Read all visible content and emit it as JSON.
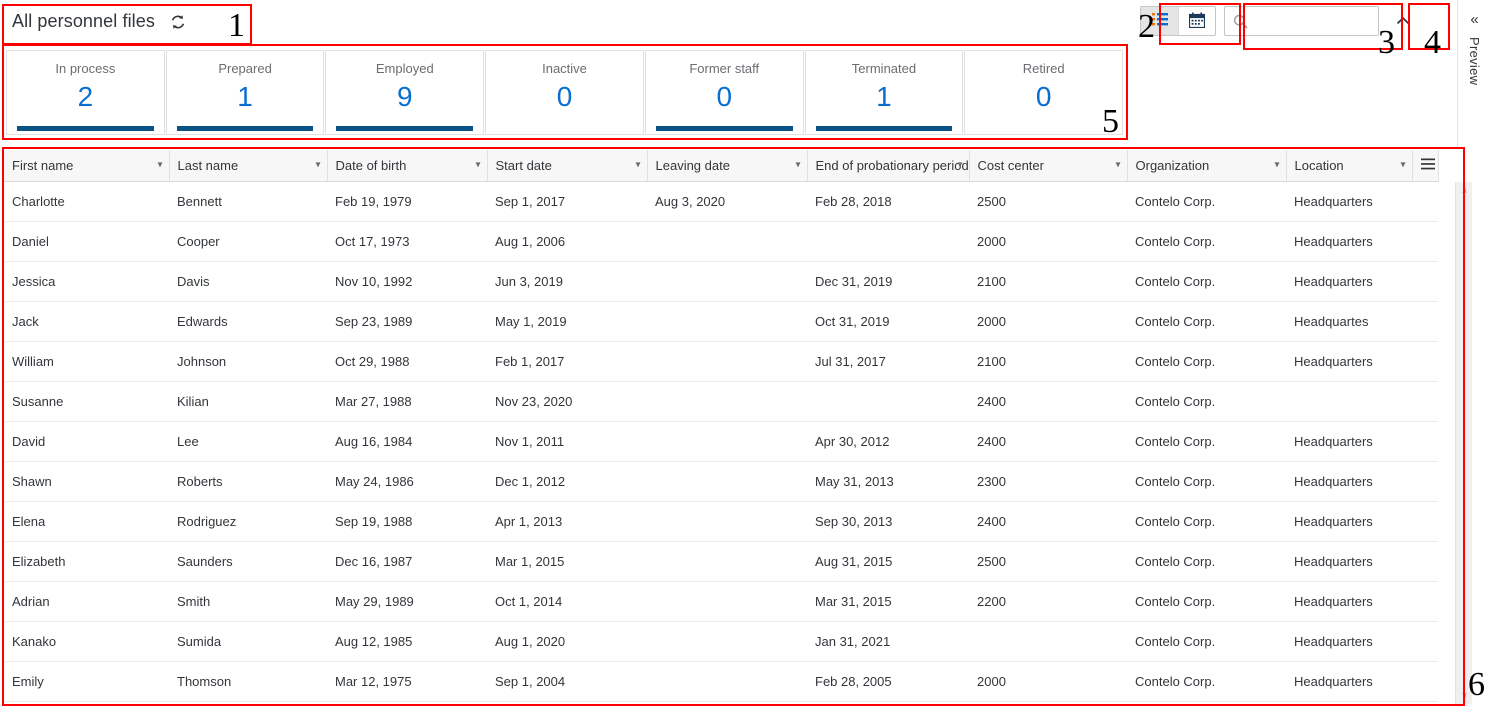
{
  "header": {
    "title": "All personnel files",
    "refresh_icon": "refresh-icon"
  },
  "toolbar": {
    "view_buttons": [
      {
        "icon": "list-view-icon",
        "label": "List view",
        "selected": true
      },
      {
        "icon": "calendar-view-icon",
        "label": "Calendar view",
        "selected": false
      }
    ],
    "search": {
      "placeholder": "",
      "value": "",
      "icon": "search-icon"
    },
    "collapse_icon": "chevron-up-icon"
  },
  "preview_rail": {
    "chevron": "«",
    "label": "Preview"
  },
  "kpis": [
    {
      "label": "In process",
      "value": "2",
      "bar": true
    },
    {
      "label": "Prepared",
      "value": "1",
      "bar": true
    },
    {
      "label": "Employed",
      "value": "9",
      "bar": true
    },
    {
      "label": "Inactive",
      "value": "0",
      "bar": false
    },
    {
      "label": "Former staff",
      "value": "0",
      "bar": true
    },
    {
      "label": "Terminated",
      "value": "1",
      "bar": true
    },
    {
      "label": "Retired",
      "value": "0",
      "bar": false
    }
  ],
  "table": {
    "columns": [
      {
        "label": "First name",
        "chevron": true
      },
      {
        "label": "Last name",
        "chevron": true
      },
      {
        "label": "Date of birth",
        "chevron": true
      },
      {
        "label": "Start date",
        "chevron": true
      },
      {
        "label": "Leaving date",
        "chevron": true
      },
      {
        "label": "End of probationary period",
        "chevron": true
      },
      {
        "label": "Cost center",
        "chevron": true
      },
      {
        "label": "Organization",
        "chevron": true
      },
      {
        "label": "Location",
        "chevron": true
      }
    ],
    "settings_icon": "table-settings-icon",
    "rows": [
      {
        "first_name": "Charlotte",
        "last_name": "Bennett",
        "dob": "Feb 19, 1979",
        "start": "Sep 1, 2017",
        "leaving": "Aug 3, 2020",
        "probation_end": "Feb 28, 2018",
        "cost_center": "2500",
        "organization": "Contelo Corp.",
        "location": "Headquarters"
      },
      {
        "first_name": "Daniel",
        "last_name": "Cooper",
        "dob": "Oct 17, 1973",
        "start": "Aug 1, 2006",
        "leaving": "",
        "probation_end": "",
        "cost_center": "2000",
        "organization": "Contelo Corp.",
        "location": "Headquarters"
      },
      {
        "first_name": "Jessica",
        "last_name": "Davis",
        "dob": "Nov 10, 1992",
        "start": "Jun 3, 2019",
        "leaving": "",
        "probation_end": "Dec 31, 2019",
        "cost_center": "2100",
        "organization": "Contelo Corp.",
        "location": "Headquarters"
      },
      {
        "first_name": "Jack",
        "last_name": "Edwards",
        "dob": "Sep 23, 1989",
        "start": "May 1, 2019",
        "leaving": "",
        "probation_end": "Oct 31, 2019",
        "cost_center": "2000",
        "organization": "Contelo Corp.",
        "location": "Headquartes"
      },
      {
        "first_name": "William",
        "last_name": "Johnson",
        "dob": "Oct 29, 1988",
        "start": "Feb 1, 2017",
        "leaving": "",
        "probation_end": "Jul 31, 2017",
        "cost_center": "2100",
        "organization": "Contelo Corp.",
        "location": "Headquarters"
      },
      {
        "first_name": "Susanne",
        "last_name": "Kilian",
        "dob": "Mar 27, 1988",
        "start": "Nov 23, 2020",
        "leaving": "",
        "probation_end": "",
        "cost_center": "2400",
        "organization": "Contelo Corp.",
        "location": ""
      },
      {
        "first_name": "David",
        "last_name": "Lee",
        "dob": "Aug 16, 1984",
        "start": "Nov 1, 2011",
        "leaving": "",
        "probation_end": "Apr 30, 2012",
        "cost_center": "2400",
        "organization": "Contelo Corp.",
        "location": "Headquarters"
      },
      {
        "first_name": "Shawn",
        "last_name": "Roberts",
        "dob": "May 24, 1986",
        "start": "Dec 1, 2012",
        "leaving": "",
        "probation_end": "May 31, 2013",
        "cost_center": "2300",
        "organization": "Contelo Corp.",
        "location": "Headquarters"
      },
      {
        "first_name": "Elena",
        "last_name": "Rodriguez",
        "dob": "Sep 19, 1988",
        "start": "Apr 1, 2013",
        "leaving": "",
        "probation_end": "Sep 30, 2013",
        "cost_center": "2400",
        "organization": "Contelo Corp.",
        "location": "Headquarters"
      },
      {
        "first_name": "Elizabeth",
        "last_name": "Saunders",
        "dob": "Dec 16, 1987",
        "start": "Mar 1, 2015",
        "leaving": "",
        "probation_end": "Aug 31, 2015",
        "cost_center": "2500",
        "organization": "Contelo Corp.",
        "location": "Headquarters"
      },
      {
        "first_name": "Adrian",
        "last_name": "Smith",
        "dob": "May 29, 1989",
        "start": "Oct 1, 2014",
        "leaving": "",
        "probation_end": "Mar 31, 2015",
        "cost_center": "2200",
        "organization": "Contelo Corp.",
        "location": "Headquarters"
      },
      {
        "first_name": "Kanako",
        "last_name": "Sumida",
        "dob": "Aug 12, 1985",
        "start": "Aug 1, 2020",
        "leaving": "",
        "probation_end": "Jan 31, 2021",
        "cost_center": "",
        "organization": "Contelo Corp.",
        "location": "Headquarters"
      },
      {
        "first_name": "Emily",
        "last_name": "Thomson",
        "dob": "Mar 12, 1975",
        "start": "Sep 1, 2004",
        "leaving": "",
        "probation_end": "Feb 28, 2005",
        "cost_center": "2000",
        "organization": "Contelo Corp.",
        "location": "Headquarters"
      }
    ]
  },
  "scrollbar": {
    "up_arrow": "∧",
    "down_arrow": "∨"
  },
  "annotations": [
    {
      "number": "1"
    },
    {
      "number": "2"
    },
    {
      "number": "3"
    },
    {
      "number": "4"
    },
    {
      "number": "5"
    },
    {
      "number": "6"
    }
  ],
  "colors": {
    "accent_value": "#0a6ed1",
    "kpi_bar": "#0a5384",
    "annotation": "#ff0000",
    "text": "#32363a",
    "muted_text": "#6a6d70"
  }
}
